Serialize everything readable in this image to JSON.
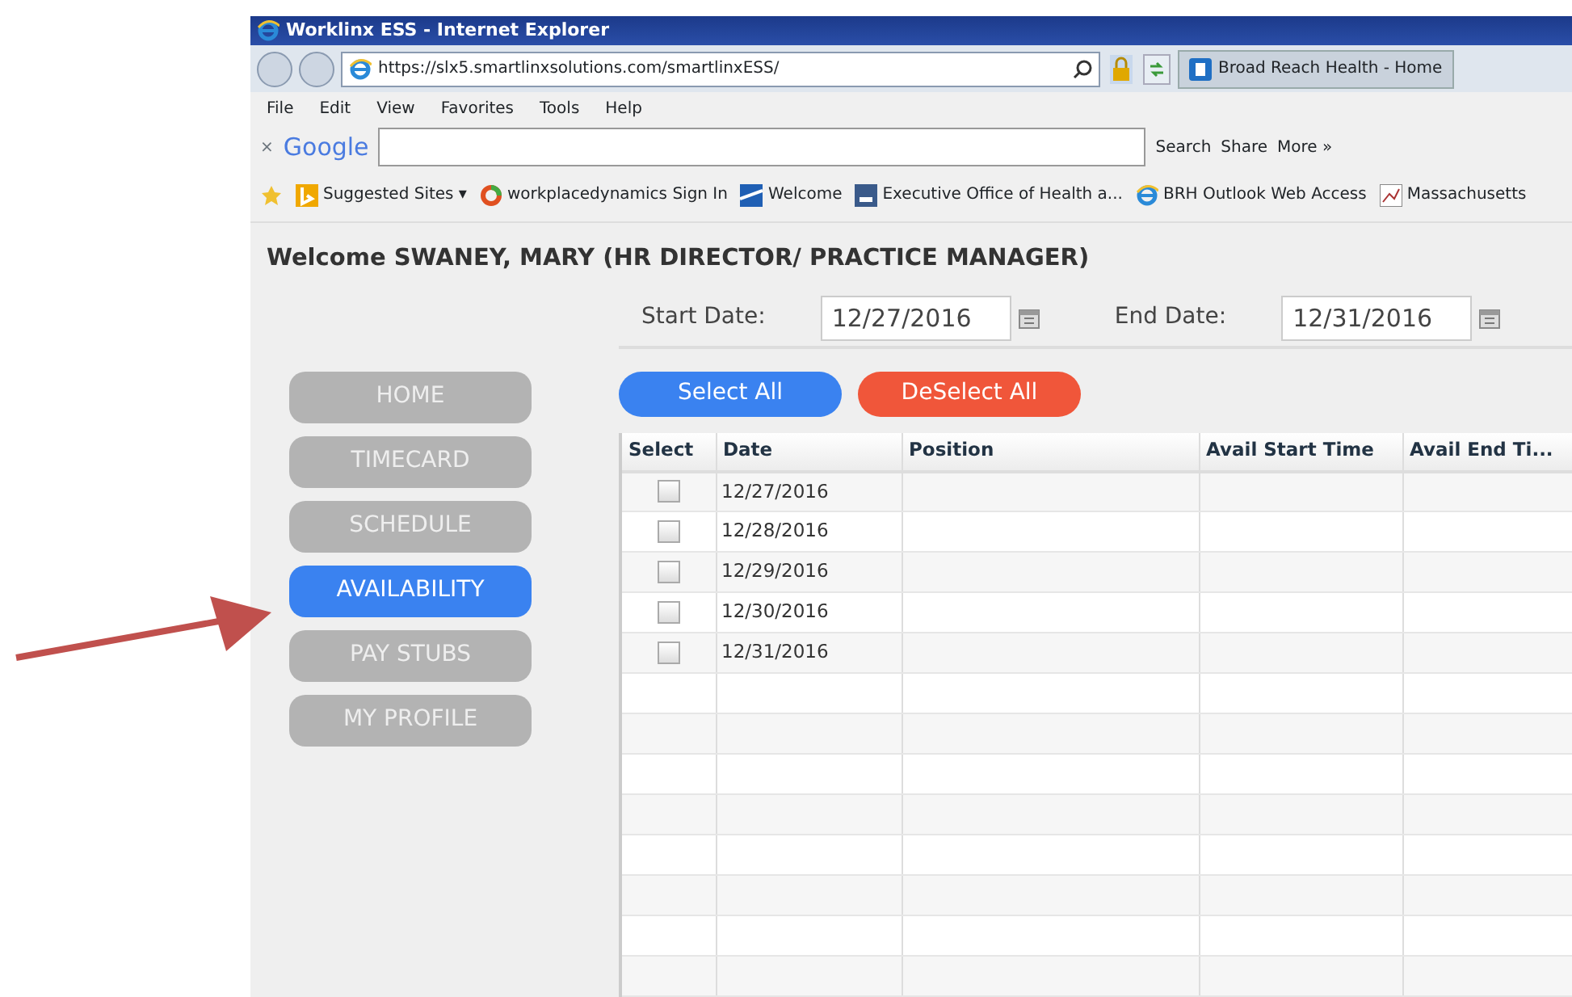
{
  "browser": {
    "title": "Worklinx ESS - Internet Explorer",
    "url": "https://slx5.smartlinxsolutions.com/smartlinxESS/",
    "tab": "Broad Reach Health - Home",
    "menu": [
      "File",
      "Edit",
      "View",
      "Favorites",
      "Tools",
      "Help"
    ],
    "google": {
      "close": "×",
      "logo": "Google",
      "search": "Search",
      "share": "Share",
      "more": "More »"
    },
    "favorites": [
      {
        "label": "Suggested Sites ▾",
        "kind": "bing"
      },
      {
        "label": "workplacedynamics Sign In",
        "kind": "ring"
      },
      {
        "label": "Welcome",
        "kind": "flag"
      },
      {
        "label": "Executive Office of Health a...",
        "kind": "doc"
      },
      {
        "label": "BRH  Outlook Web Access",
        "kind": "ie"
      },
      {
        "label": "Massachusetts",
        "kind": "chart"
      }
    ]
  },
  "page": {
    "welcome": "Welcome SWANEY, MARY (HR DIRECTOR/ PRACTICE MANAGER)",
    "start_label": "Start Date:",
    "start_value": "12/27/2016",
    "end_label": "End Date:",
    "end_value": "12/31/2016",
    "select_all": "Select All",
    "deselect_all": "DeSelect All",
    "nav": [
      {
        "label": "HOME",
        "selected": false
      },
      {
        "label": "TIMECARD",
        "selected": false
      },
      {
        "label": "SCHEDULE",
        "selected": false
      },
      {
        "label": "AVAILABILITY",
        "selected": true
      },
      {
        "label": "PAY STUBS",
        "selected": false
      },
      {
        "label": "MY PROFILE",
        "selected": false
      }
    ],
    "table": {
      "columns": [
        "Select",
        "Date",
        "Position",
        "Avail Start Time",
        "Avail End Ti..."
      ],
      "rows": [
        {
          "checked": false,
          "date": "12/27/2016"
        },
        {
          "checked": false,
          "date": "12/28/2016"
        },
        {
          "checked": false,
          "date": "12/29/2016"
        },
        {
          "checked": false,
          "date": "12/30/2016"
        },
        {
          "checked": false,
          "date": "12/31/2016"
        }
      ]
    }
  }
}
